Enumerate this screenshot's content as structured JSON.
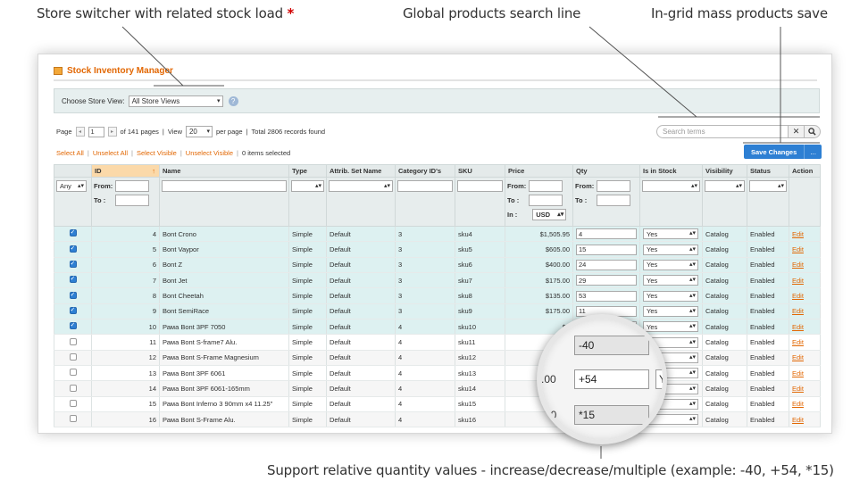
{
  "callouts": {
    "store_switcher": "Store switcher with related stock load",
    "store_switcher_star": "*",
    "global_search": "Global products search line",
    "mass_save": "In-grid mass products save",
    "relative_qty": "Support relative quantity values - increase/decrease/multiple (example: -40, +54, *15)"
  },
  "panel": {
    "title": "Stock Inventory Manager"
  },
  "store_view": {
    "label": "Choose Store View:",
    "selected": "All Store Views",
    "help_icon": "?"
  },
  "pager": {
    "page_label": "Page",
    "page_value": "1",
    "of_pages": "of 141 pages",
    "sep1": "|",
    "view_label": "View",
    "view_value": "20",
    "per_page": "per page",
    "sep2": "|",
    "total": "Total 2806 records found"
  },
  "mass_actions": {
    "select_all": "Select All",
    "unselect_all": "Unselect All",
    "select_visible": "Select Visible",
    "unselect_visible": "Unselect Visible",
    "items_selected": "0 items selected",
    "sep": "|"
  },
  "search": {
    "placeholder": "Search terms",
    "clear_icon": "✕",
    "search_icon": "🔍"
  },
  "save": {
    "label": "Save Changes",
    "more": "..."
  },
  "grid": {
    "columns": [
      "",
      "ID",
      "Name",
      "Type",
      "Attrib. Set Name",
      "Category ID's",
      "SKU",
      "Price",
      "Qty",
      "Is in Stock",
      "Visibility",
      "Status",
      "Action"
    ],
    "sort_arrow": "↑",
    "filter": {
      "any": "Any",
      "from": "From:",
      "to": "To :",
      "in": "In :",
      "currency": "USD"
    },
    "rows": [
      {
        "checked": true,
        "id": "4",
        "name": "Bont Crono",
        "type": "Simple",
        "attrib": "Default",
        "cat": "3",
        "sku": "sku4",
        "price": "$1,505.95",
        "qty": "4",
        "stock": "Yes",
        "visibility": "Catalog",
        "status": "Enabled",
        "action": "Edit"
      },
      {
        "checked": true,
        "id": "5",
        "name": "Bont Vaypor",
        "type": "Simple",
        "attrib": "Default",
        "cat": "3",
        "sku": "sku5",
        "price": "$605.00",
        "qty": "15",
        "stock": "Yes",
        "visibility": "Catalog",
        "status": "Enabled",
        "action": "Edit"
      },
      {
        "checked": true,
        "id": "6",
        "name": "Bont Z",
        "type": "Simple",
        "attrib": "Default",
        "cat": "3",
        "sku": "sku6",
        "price": "$400.00",
        "qty": "24",
        "stock": "Yes",
        "visibility": "Catalog",
        "status": "Enabled",
        "action": "Edit"
      },
      {
        "checked": true,
        "id": "7",
        "name": "Bont Jet",
        "type": "Simple",
        "attrib": "Default",
        "cat": "3",
        "sku": "sku7",
        "price": "$175.00",
        "qty": "29",
        "stock": "Yes",
        "visibility": "Catalog",
        "status": "Enabled",
        "action": "Edit"
      },
      {
        "checked": true,
        "id": "8",
        "name": "Bont Cheetah",
        "type": "Simple",
        "attrib": "Default",
        "cat": "3",
        "sku": "sku8",
        "price": "$135.00",
        "qty": "53",
        "stock": "Yes",
        "visibility": "Catalog",
        "status": "Enabled",
        "action": "Edit"
      },
      {
        "checked": true,
        "id": "9",
        "name": "Bont SemiRace",
        "type": "Simple",
        "attrib": "Default",
        "cat": "3",
        "sku": "sku9",
        "price": "$175.00",
        "qty": "11",
        "stock": "Yes",
        "visibility": "Catalog",
        "status": "Enabled",
        "action": "Edit"
      },
      {
        "checked": true,
        "id": "10",
        "name": "Рама Bont 3PF 7050",
        "type": "Simple",
        "attrib": "Default",
        "cat": "4",
        "sku": "sku10",
        "price": "$2",
        "qty": "",
        "stock": "Yes",
        "visibility": "Catalog",
        "status": "Enabled",
        "action": "Edit"
      },
      {
        "checked": false,
        "id": "11",
        "name": "Рама Bont S-frame7 Alu.",
        "type": "Simple",
        "attrib": "Default",
        "cat": "4",
        "sku": "sku11",
        "price": "$2",
        "qty": "",
        "stock": "",
        "visibility": "Catalog",
        "status": "Enabled",
        "action": "Edit"
      },
      {
        "checked": false,
        "id": "12",
        "name": "Рама Bont S-Frame Magnesium",
        "type": "Simple",
        "attrib": "Default",
        "cat": "4",
        "sku": "sku12",
        "price": "$2",
        "qty": "",
        "stock": "",
        "visibility": "Catalog",
        "status": "Enabled",
        "action": "Edit"
      },
      {
        "checked": false,
        "id": "13",
        "name": "Рама Bont 3PF 6061",
        "type": "Simple",
        "attrib": "Default",
        "cat": "4",
        "sku": "sku13",
        "price": "",
        "qty": "",
        "stock": "",
        "visibility": "Catalog",
        "status": "Enabled",
        "action": "Edit"
      },
      {
        "checked": false,
        "id": "14",
        "name": "Рама Bont 3PF 6061-165mm",
        "type": "Simple",
        "attrib": "Default",
        "cat": "4",
        "sku": "sku14",
        "price": "",
        "qty": "",
        "stock": "",
        "visibility": "Catalog",
        "status": "Enabled",
        "action": "Edit"
      },
      {
        "checked": false,
        "id": "15",
        "name": "Рама Bont Inferno 3 90mm x4 11.25\"",
        "type": "Simple",
        "attrib": "Default",
        "cat": "4",
        "sku": "sku15",
        "price": "",
        "qty": "",
        "stock": "",
        "visibility": "Catalog",
        "status": "Enabled",
        "action": "Edit"
      },
      {
        "checked": false,
        "id": "16",
        "name": "Рама Bont S-Frame Alu.",
        "type": "Simple",
        "attrib": "Default",
        "cat": "4",
        "sku": "sku16",
        "price": "$2",
        "qty": "",
        "stock": "",
        "visibility": "Catalog",
        "status": "Enabled",
        "action": "Edit"
      }
    ]
  },
  "magnifier": {
    "value1": "-40",
    "left2": ".00",
    "value2": "+54",
    "right2": "Y",
    "left3": "00",
    "value3": "*15"
  }
}
